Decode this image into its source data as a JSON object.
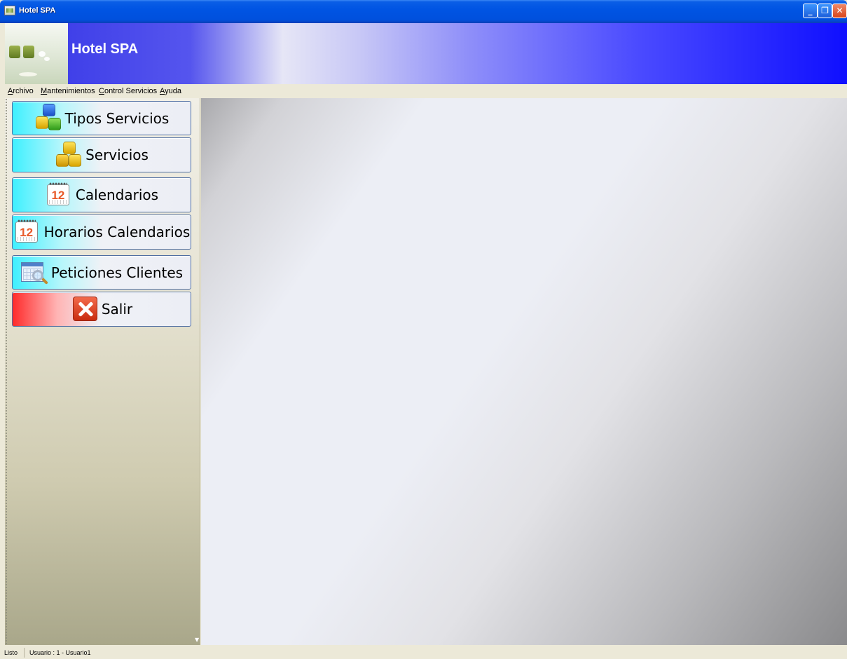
{
  "window": {
    "title": "Hotel SPA",
    "controls": [
      "minimize",
      "restore",
      "close"
    ]
  },
  "banner": {
    "title": "Hotel SPA"
  },
  "menu": {
    "items": [
      "Archivo",
      "Mantenimientos",
      "Control Servicios",
      "Ayuda"
    ]
  },
  "sidebar": {
    "buttons": [
      {
        "label": "Tipos Servicios",
        "icon": "cubes-icon"
      },
      {
        "label": "Servicios",
        "icon": "yellow-cubes-icon"
      },
      {
        "label": "Calendarios",
        "icon": "calendar-icon",
        "icon_text": "12"
      },
      {
        "label": "Horarios Calendarios",
        "icon": "calendar-icon",
        "icon_text": "12"
      },
      {
        "label": "Peticiones Clientes",
        "icon": "search-window-icon"
      },
      {
        "label": "Salir",
        "icon": "exit-icon"
      }
    ]
  },
  "status": {
    "state": "Listo",
    "user": "Usuario : 1 - Usuario1"
  },
  "colors": {
    "titlebar": "#0054e3",
    "accent_cyan": "#3ff0ff",
    "accent_red": "#ff2b2b",
    "banner_blue": "#0f0fff"
  }
}
